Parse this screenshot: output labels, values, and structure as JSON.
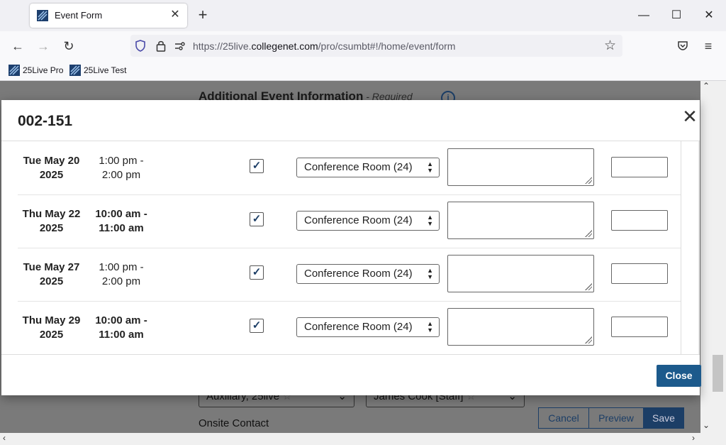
{
  "browser": {
    "tab_title": "Event Form",
    "url_prefix": "https://25live.",
    "url_domain": "collegenet.com",
    "url_path": "/pro/csumbt#!/home/event/form",
    "bookmarks": [
      "25Live Pro",
      "25Live Test"
    ]
  },
  "page": {
    "heading": "Additional Event Information",
    "heading_required": " - Required",
    "info_icon": "i",
    "field1": "Auxiliary, 25live",
    "field2": "James Cook [Staff]",
    "onsite_label": "Onsite Contact",
    "cancel": "Cancel",
    "preview": "Preview",
    "save": "Save"
  },
  "modal": {
    "title": "002-151",
    "close_label": "Close",
    "rows": [
      {
        "date1": "Tue May 20",
        "date2": "2025",
        "time1": "1:00 pm -",
        "time2": "2:00 pm",
        "bold_time": false,
        "checked": "✓",
        "room": "Conference Room (24)"
      },
      {
        "date1": "Thu May 22",
        "date2": "2025",
        "time1": "10:00 am -",
        "time2": "11:00 am",
        "bold_time": true,
        "checked": "✓",
        "room": "Conference Room (24)"
      },
      {
        "date1": "Tue May 27",
        "date2": "2025",
        "time1": "1:00 pm -",
        "time2": "2:00 pm",
        "bold_time": false,
        "checked": "✓",
        "room": "Conference Room (24)"
      },
      {
        "date1": "Thu May 29",
        "date2": "2025",
        "time1": "10:00 am -",
        "time2": "11:00 am",
        "bold_time": true,
        "checked": "✓",
        "room": "Conference Room (24)"
      }
    ]
  }
}
